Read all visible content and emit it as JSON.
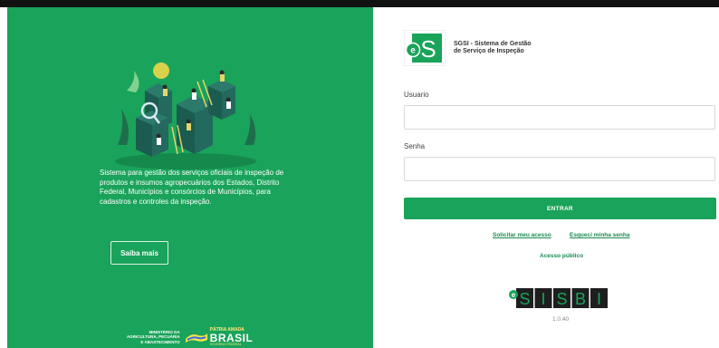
{
  "left_panel": {
    "description": "Sistema para gestão dos serviços oficiais de inspeção de produtos e insumos agropecuários dos Estados, Distrito Federal, Municípios e consórcios de Municípios, para cadastros e controles da inspeção.",
    "saiba_mais_label": "Saiba mais",
    "gov": {
      "ministry_line1": "MINISTÉRIO DA",
      "ministry_line2": "AGRICULTURA, PECUÁRIA",
      "ministry_line3": "E ABASTECIMENTO",
      "patria": "PÁTRIA AMADA",
      "brasil": "BRASIL",
      "governo": "GOVERNO FEDERAL"
    }
  },
  "header": {
    "logo_letters": "eS",
    "app_name_line1": "SGSI - Sistema de Gestão",
    "app_name_line2": "de Serviço de Inspeção"
  },
  "form": {
    "usuario_label": "Usuario",
    "usuario_value": "",
    "senha_label": "Senha",
    "senha_value": "",
    "entrar_label": "ENTRAR"
  },
  "links": {
    "solicitar": "Solicitar meu acesso",
    "esqueci": "Esqueci minha senha",
    "acesso_publico": "Acesso público"
  },
  "footer": {
    "sisbi_prefix": "e",
    "sisbi_letters": [
      "S",
      "I",
      "S",
      "B",
      "I"
    ],
    "version": "1.0.40"
  },
  "colors": {
    "brand_green": "#1aa35a",
    "link_green": "#1a8a4f",
    "top_bar": "#111111"
  }
}
